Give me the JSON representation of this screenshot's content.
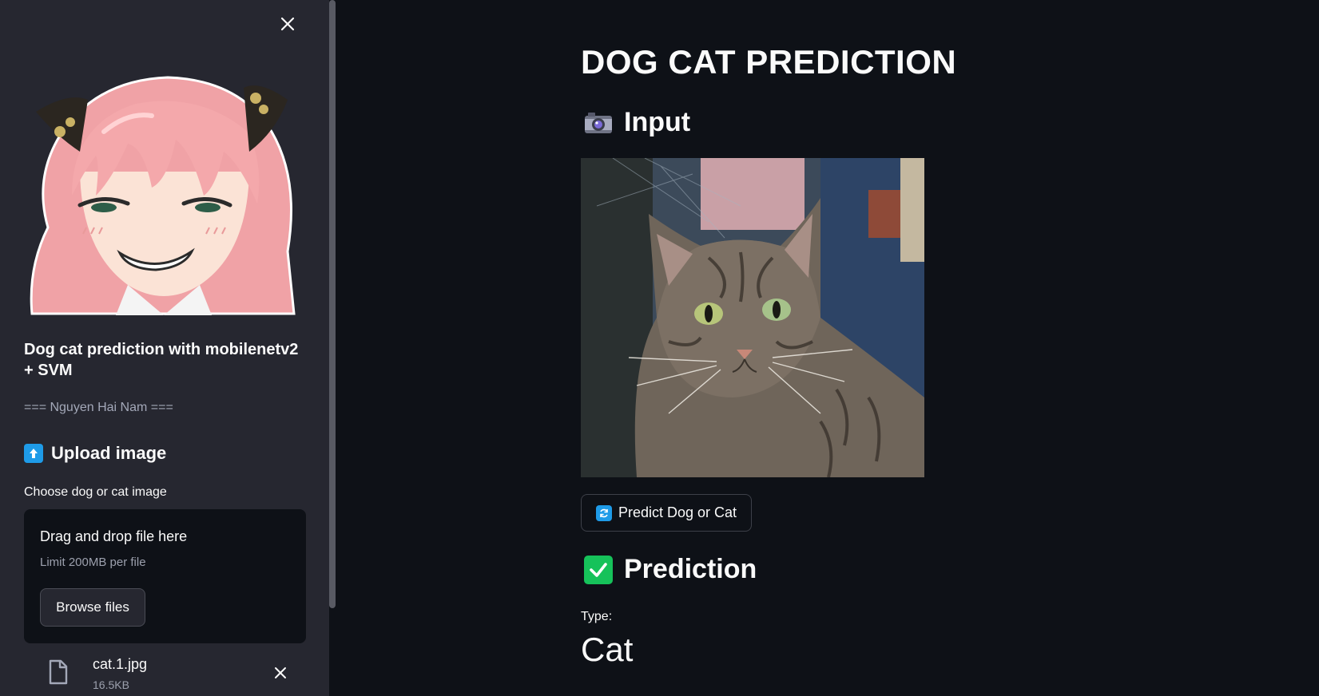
{
  "sidebar": {
    "title": "Dog cat prediction with mobilenetv2 + SVM",
    "author": "=== Nguyen Hai Nam ===",
    "upload_header": "Upload image",
    "upload_icon": "up-arrow-icon",
    "uploader_label": "Choose dog or cat image",
    "dropzone": {
      "title": "Drag and drop file here",
      "limit": "Limit 200MB per file",
      "browse_label": "Browse files"
    },
    "file": {
      "name": "cat.1.jpg",
      "size": "16.5KB"
    }
  },
  "main": {
    "title": "DOG CAT PREDICTION",
    "input_header": "Input",
    "input_icon": "camera-icon",
    "predict_button": "Predict Dog or Cat",
    "predict_icon": "refresh-icon",
    "prediction_header": "Prediction",
    "prediction_icon": "check-mark-icon",
    "type_label": "Type:",
    "type_value": "Cat"
  },
  "colors": {
    "background": "#0e1117",
    "sidebar": "#262730",
    "accent_blue": "#1e9be8",
    "check_green": "#16c25a"
  }
}
